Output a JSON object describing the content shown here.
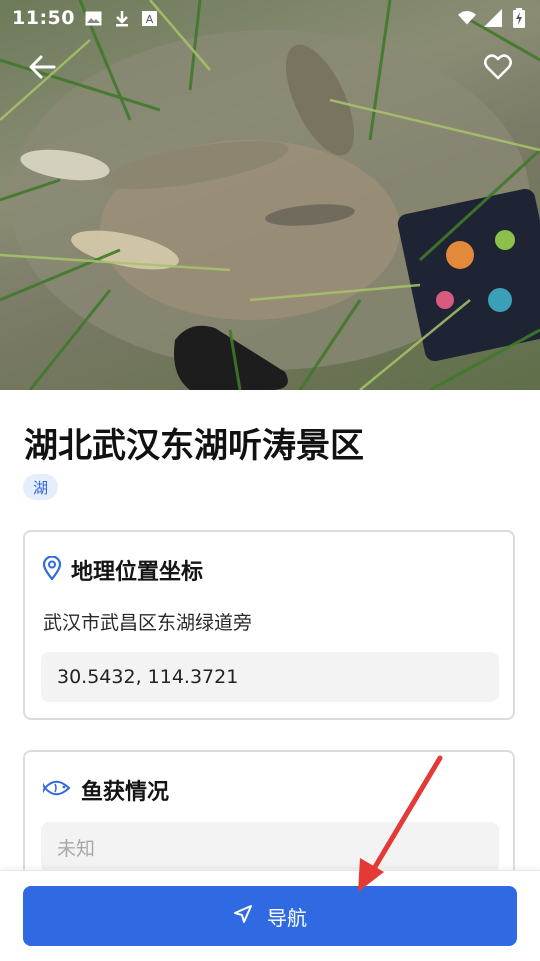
{
  "status_bar": {
    "time": "11:50",
    "icons": [
      "image-icon",
      "download-icon",
      "font-icon",
      "wifi-icon",
      "signal-icon",
      "battery-charging-icon"
    ]
  },
  "header": {
    "back_icon": "arrow-left-icon",
    "favorite_icon": "heart-outline-icon"
  },
  "spot": {
    "name": "湖北武汉东湖听涛景区",
    "type_tag": "湖"
  },
  "location_card": {
    "icon": "map-pin-icon",
    "title": "地理位置坐标",
    "address": "武汉市武昌区东湖绿道旁",
    "coordinates": "30.5432, 114.3721"
  },
  "catch_card": {
    "icon": "fish-icon",
    "title": "鱼获情况",
    "value": "未知"
  },
  "action": {
    "icon": "navigation-arrow-icon",
    "label": "导航"
  },
  "colors": {
    "accent": "#2f6ae3",
    "tag_bg": "#e6eefb",
    "annotation_arrow": "#e53935"
  }
}
